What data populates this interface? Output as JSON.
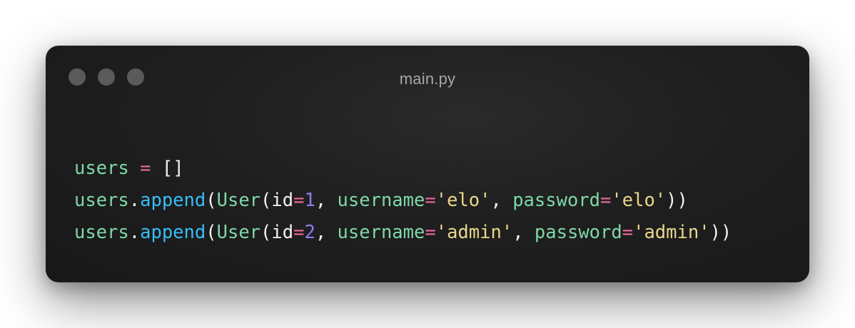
{
  "window": {
    "filename": "main.py",
    "colors": {
      "dot": "#5a5a5a",
      "title": "#a6a6a6",
      "identifier": "#7ed8a8",
      "operator": "#f06a9a",
      "plain": "#f2f2f2",
      "method": "#38bdf8",
      "number": "#8c7cf0",
      "string": "#e8d88a"
    },
    "traffic_lights": [
      "close-dot",
      "minimize-dot",
      "maximize-dot"
    ]
  },
  "code": {
    "lines": [
      [
        {
          "text": "users",
          "type": "identifier"
        },
        {
          "text": " ",
          "type": "plain"
        },
        {
          "text": "=",
          "type": "operator"
        },
        {
          "text": " []",
          "type": "plain"
        }
      ],
      [
        {
          "text": "users",
          "type": "identifier"
        },
        {
          "text": ".",
          "type": "plain"
        },
        {
          "text": "append",
          "type": "method"
        },
        {
          "text": "(",
          "type": "plain"
        },
        {
          "text": "User",
          "type": "identifier"
        },
        {
          "text": "(id",
          "type": "plain"
        },
        {
          "text": "=",
          "type": "operator"
        },
        {
          "text": "1",
          "type": "number"
        },
        {
          "text": ", ",
          "type": "plain"
        },
        {
          "text": "username",
          "type": "identifier"
        },
        {
          "text": "=",
          "type": "operator"
        },
        {
          "text": "'elo'",
          "type": "string"
        },
        {
          "text": ", ",
          "type": "plain"
        },
        {
          "text": "password",
          "type": "identifier"
        },
        {
          "text": "=",
          "type": "operator"
        },
        {
          "text": "'elo'",
          "type": "string"
        },
        {
          "text": "))",
          "type": "plain"
        }
      ],
      [
        {
          "text": "users",
          "type": "identifier"
        },
        {
          "text": ".",
          "type": "plain"
        },
        {
          "text": "append",
          "type": "method"
        },
        {
          "text": "(",
          "type": "plain"
        },
        {
          "text": "User",
          "type": "identifier"
        },
        {
          "text": "(id",
          "type": "plain"
        },
        {
          "text": "=",
          "type": "operator"
        },
        {
          "text": "2",
          "type": "number"
        },
        {
          "text": ", ",
          "type": "plain"
        },
        {
          "text": "username",
          "type": "identifier"
        },
        {
          "text": "=",
          "type": "operator"
        },
        {
          "text": "'admin'",
          "type": "string"
        },
        {
          "text": ", ",
          "type": "plain"
        },
        {
          "text": "password",
          "type": "identifier"
        },
        {
          "text": "=",
          "type": "operator"
        },
        {
          "text": "'admin'",
          "type": "string"
        },
        {
          "text": "))",
          "type": "plain"
        }
      ]
    ]
  }
}
